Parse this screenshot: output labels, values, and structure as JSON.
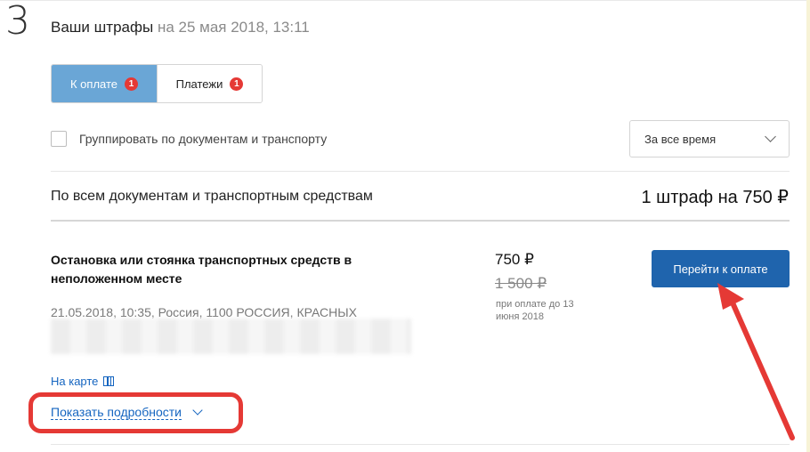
{
  "step": {
    "number": "3"
  },
  "header": {
    "title": "Ваши штрафы",
    "date": "на 25 мая 2018, 13:11"
  },
  "tabs": [
    {
      "label": "К оплате",
      "badge": "1",
      "active": true
    },
    {
      "label": "Платежи",
      "badge": "1",
      "active": false
    }
  ],
  "filters": {
    "group_label": "Группировать по документам и транспорту",
    "period_value": "За все время"
  },
  "summary": {
    "label": "По всем документам и транспортным средствам",
    "total": "1 штраф на 750 ₽"
  },
  "fine": {
    "title": "Остановка или стоянка транспортных средств в неположенном месте",
    "meta": "21.05.2018, 10:35, Россия, 1100 РОССИЯ, КРАСНЫХ",
    "price_now": "750 ₽",
    "price_old": "1 500 ₽",
    "price_note": "при оплате до 13 июня 2018",
    "pay_label": "Перейти к оплате",
    "map_label": "На карте",
    "details_label": "Показать подробности"
  },
  "colors": {
    "accent": "#1f64ad",
    "tab_active": "#6aa6d6",
    "badge": "#e53935",
    "annotation": "#e53935",
    "link": "#1565c0"
  }
}
